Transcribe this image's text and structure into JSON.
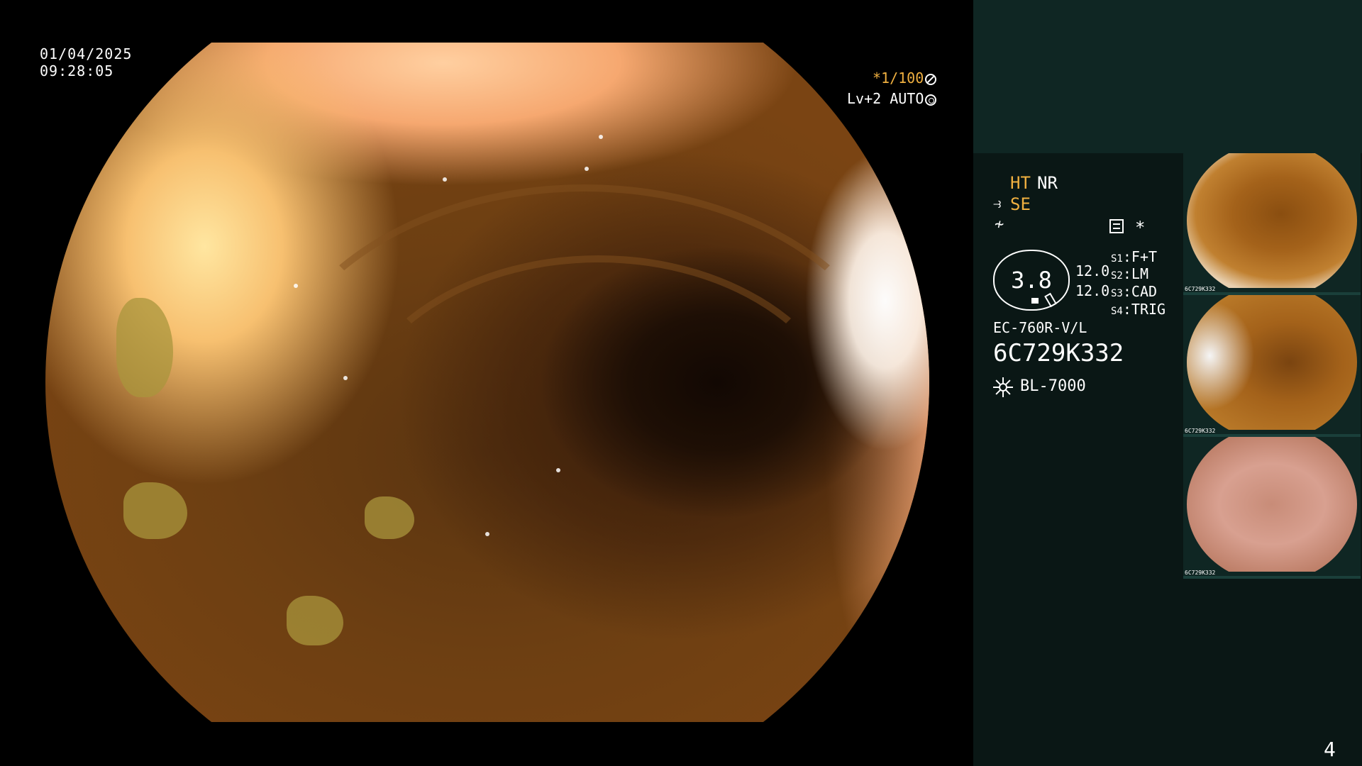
{
  "overlay": {
    "date": "01/04/2025",
    "time": "09:28:05",
    "shutter": "*1/100",
    "level": "Lv+2 AUTO"
  },
  "panel": {
    "ht": "HT",
    "nr": "NR",
    "se": "SE",
    "gauge_value": "3.8",
    "val1": "12.0",
    "val2": "12.0",
    "switches": [
      {
        "key": "S1",
        "value": "F+T"
      },
      {
        "key": "S2",
        "value": "LM"
      },
      {
        "key": "S3",
        "value": "CAD"
      },
      {
        "key": "S4",
        "value": "TRIG"
      }
    ],
    "scope_model": "EC-760R-V/L",
    "serial": "6C729K332",
    "light_source": "BL-7000"
  },
  "thumbnails": [
    {
      "caption": "6C729K332"
    },
    {
      "caption": "6C729K332"
    },
    {
      "caption": "6C729K332"
    }
  ],
  "page_number": "4",
  "colors": {
    "accent": "#f0b040",
    "panel_bg": "#0a1715",
    "panel_header": "#0f2623"
  }
}
